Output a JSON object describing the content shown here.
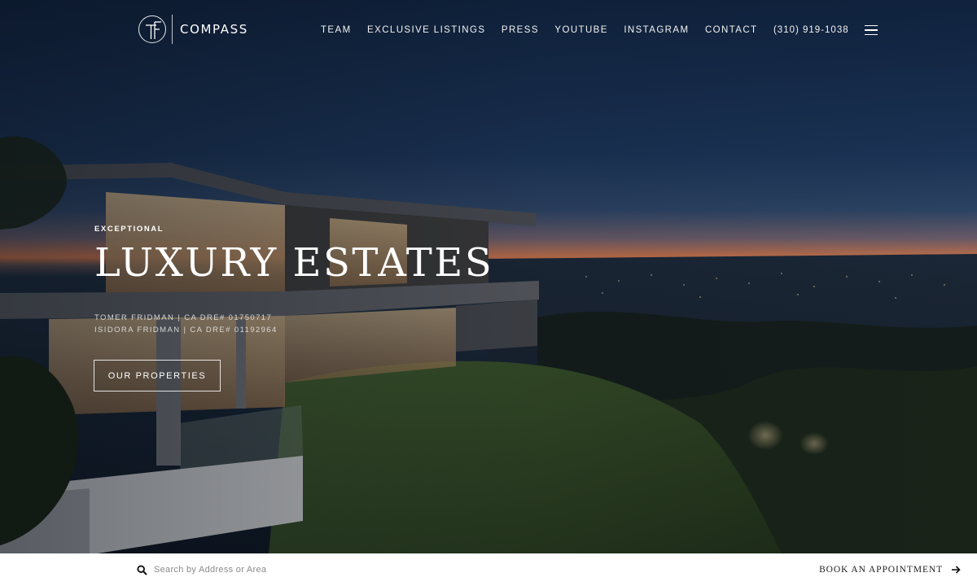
{
  "brand": {
    "monogram": "TF",
    "name": "COMPASS"
  },
  "nav": {
    "items": [
      {
        "label": "TEAM"
      },
      {
        "label": "EXCLUSIVE LISTINGS"
      },
      {
        "label": "PRESS"
      },
      {
        "label": "YOUTUBE"
      },
      {
        "label": "INSTAGRAM"
      },
      {
        "label": "CONTACT"
      }
    ],
    "phone": "(310) 919-1038",
    "menu_icon": "hamburger-menu-icon"
  },
  "hero": {
    "eyebrow": "EXCEPTIONAL",
    "headline": "LUXURY ESTATES",
    "agents": [
      "TOMER FRIDMAN | CA DRE# 01750717",
      "ISIDORA FRIDMAN | CA DRE# 01192964"
    ],
    "cta_label": "OUR PROPERTIES"
  },
  "bottom_bar": {
    "search_placeholder": "Search by Address or Area",
    "search_icon": "search-icon",
    "book_label": "BOOK AN APPOINTMENT",
    "book_icon": "arrow-right-icon"
  },
  "colors": {
    "sky_top": "#13294a",
    "sunset": "#c9734a",
    "text": "#ffffff",
    "bar_background": "#ffffff"
  }
}
